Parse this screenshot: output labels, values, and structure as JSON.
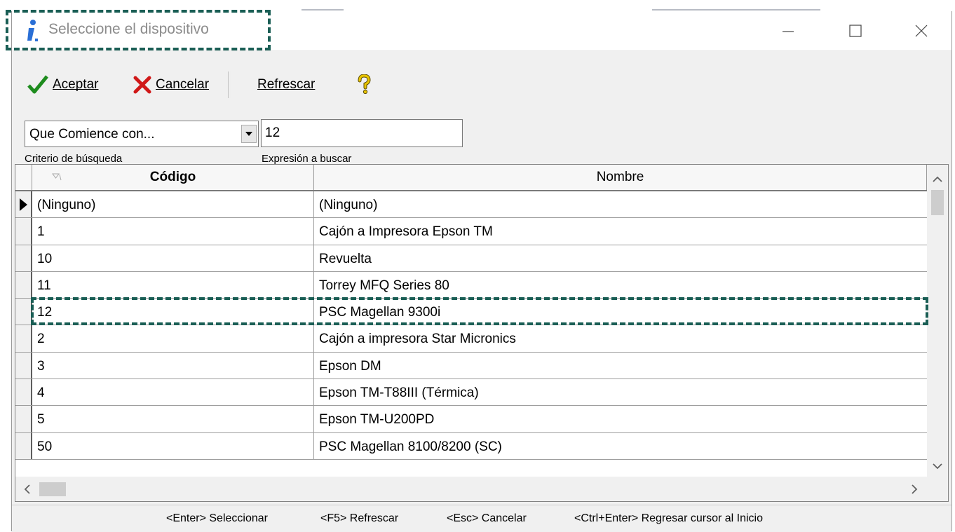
{
  "window": {
    "title": "Seleccione el dispositivo"
  },
  "toolbar": {
    "accept_label": "Aceptar",
    "cancel_label": "Cancelar",
    "refresh_label": "Refrescar"
  },
  "search": {
    "criteria_value": "Que Comience con...",
    "criteria_caption": "Criterio de búsqueda",
    "expression_value": "12",
    "expression_caption": "Expresión a buscar"
  },
  "grid": {
    "columns": [
      "Código",
      "Nombre"
    ],
    "rows": [
      {
        "code": "(Ninguno)",
        "name": "(Ninguno)"
      },
      {
        "code": "1",
        "name": "Cajón a Impresora Epson TM"
      },
      {
        "code": "10",
        "name": "Revuelta"
      },
      {
        "code": "11",
        "name": "Torrey MFQ Series 80"
      },
      {
        "code": "12",
        "name": "PSC Magellan 9300i"
      },
      {
        "code": "2",
        "name": "Cajón a impresora Star Micronics"
      },
      {
        "code": "3",
        "name": "Epson DM"
      },
      {
        "code": "4",
        "name": "Epson TM-T88III (Térmica)"
      },
      {
        "code": "5",
        "name": "Epson TM-U200PD"
      },
      {
        "code": "50",
        "name": "PSC Magellan 8100/8200 (SC)"
      }
    ]
  },
  "statusbar": {
    "hints": [
      "<Enter> Seleccionar",
      "<F5> Refrescar",
      "<Esc> Cancelar",
      "<Ctrl+Enter> Regresar cursor al Inicio"
    ]
  },
  "colors": {
    "highlight": "#1a5e55",
    "accept_icon": "#1e8c1e",
    "cancel_icon": "#d01818",
    "help_icon": "#d8b400",
    "title_icon": "#2a6fd6"
  },
  "icons": {
    "title": "info-icon",
    "accept": "checkmark-icon",
    "cancel": "x-icon",
    "help": "question-mark-icon",
    "sort": "sort-icon"
  }
}
